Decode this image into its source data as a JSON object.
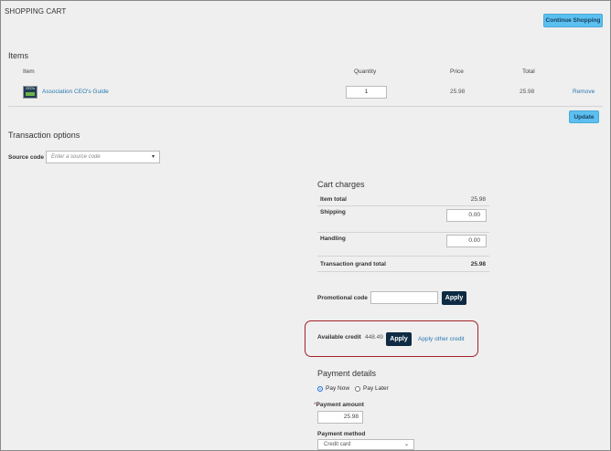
{
  "page": {
    "title": "SHOPPING CART",
    "continue_label": "Continue Shopping"
  },
  "items": {
    "heading": "Items",
    "columns": {
      "item": "Item",
      "quantity": "Quantity",
      "price": "Price",
      "total": "Total"
    },
    "rows": [
      {
        "thumb_text": "CEO's",
        "name": "Association CEO's Guide",
        "quantity": "1",
        "price": "25.98",
        "total": "25.98",
        "remove": "Remove"
      }
    ],
    "update_label": "Update"
  },
  "transaction": {
    "heading": "Transaction options",
    "source_code_label": "Source code",
    "source_code_placeholder": "Enter a source code"
  },
  "cart_charges": {
    "heading": "Cart charges",
    "item_total_label": "Item total",
    "item_total_value": "25.98",
    "shipping_label": "Shipping",
    "shipping_value": "0.00",
    "handling_label": "Handling",
    "handling_value": "0.00",
    "grand_total_label": "Transaction grand total",
    "grand_total_value": "25.98"
  },
  "promo": {
    "label": "Promotional code",
    "value": "",
    "apply_label": "Apply"
  },
  "credit": {
    "label": "Available credit",
    "amount": "448.49",
    "apply_label": "Apply",
    "other_label": "Apply other credit",
    "highlight_color": "#a3212a"
  },
  "payment": {
    "heading": "Payment details",
    "options": [
      "Pay Now",
      "Pay Later"
    ],
    "selected": "Pay Now",
    "required_mark": "*",
    "amount_label": "Payment amount",
    "amount_value": "25.98",
    "method_label": "Payment method",
    "method_value": "Credit card"
  }
}
